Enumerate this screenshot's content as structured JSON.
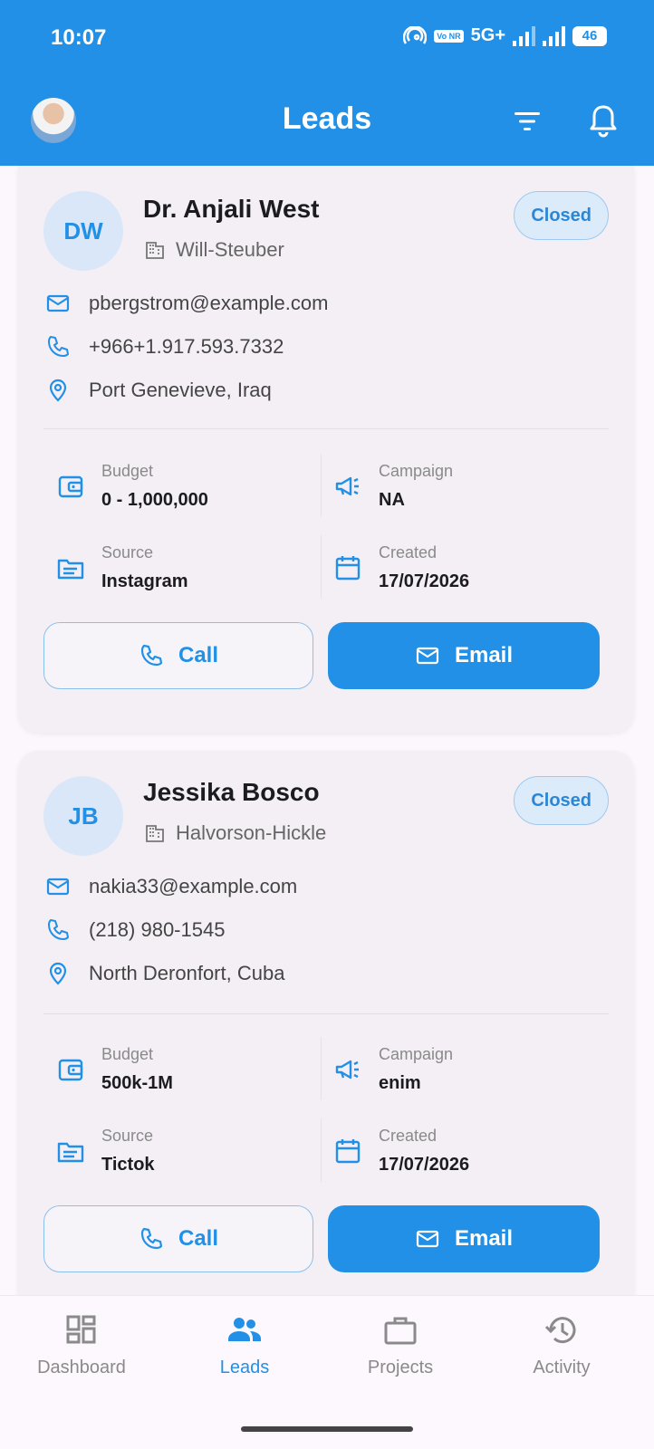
{
  "status_bar": {
    "time": "10:07",
    "network": "5G+",
    "volte": "Vo NR",
    "battery": "46"
  },
  "app_bar": {
    "title": "Leads"
  },
  "leads": [
    {
      "initials": "DW",
      "name": "Dr. Anjali West",
      "company": "Will-Steuber",
      "status": "Closed",
      "email": "pbergstrom@example.com",
      "phone": "+966+1.917.593.7332",
      "location": "Port Genevieve, Iraq",
      "budget_label": "Budget",
      "budget": "0 - 1,000,000",
      "campaign_label": "Campaign",
      "campaign": "NA",
      "source_label": "Source",
      "source": "Instagram",
      "created_label": "Created",
      "created": "17/07/2026",
      "call_label": "Call",
      "email_label": "Email"
    },
    {
      "initials": "JB",
      "name": "Jessika Bosco",
      "company": "Halvorson-Hickle",
      "status": "Closed",
      "email": "nakia33@example.com",
      "phone": "(218) 980-1545",
      "location": "North Deronfort, Cuba",
      "budget_label": "Budget",
      "budget": "500k-1M",
      "campaign_label": "Campaign",
      "campaign": "enim",
      "source_label": "Source",
      "source": "Tictok",
      "created_label": "Created",
      "created": "17/07/2026",
      "call_label": "Call",
      "email_label": "Email"
    }
  ],
  "bottom_nav": [
    {
      "label": "Dashboard",
      "icon": "dashboard-icon",
      "active": false
    },
    {
      "label": "Leads",
      "icon": "people-icon",
      "active": true
    },
    {
      "label": "Projects",
      "icon": "briefcase-icon",
      "active": false
    },
    {
      "label": "Activity",
      "icon": "history-icon",
      "active": false
    }
  ],
  "colors": {
    "primary": "#2190e6",
    "card": "#f3eff5",
    "badge_bg": "#dcebfa"
  }
}
